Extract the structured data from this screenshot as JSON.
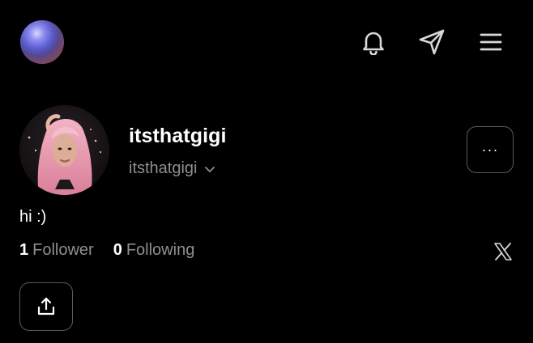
{
  "header": {
    "logo_icon": "orb-logo-icon",
    "icons": [
      "bell-icon",
      "send-icon",
      "menu-icon"
    ]
  },
  "profile": {
    "display_name": "itsthatgigi",
    "handle": "itsthatgigi",
    "bio": "hi :)",
    "more_label": "···",
    "followers": {
      "count": "1",
      "label": "Follower"
    },
    "following": {
      "count": "0",
      "label": "Following"
    },
    "social_link_icon": "x-logo-icon",
    "share_icon": "share-icon"
  },
  "colors": {
    "background": "#000000",
    "text_primary": "#ffffff",
    "text_secondary": "#8e8e93",
    "border": "#5a5a5e"
  }
}
